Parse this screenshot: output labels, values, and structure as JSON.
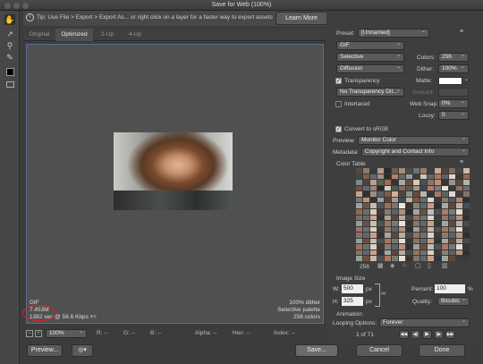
{
  "window": {
    "title": "Save for Web (100%)"
  },
  "tip": {
    "text": "Tip: Use File > Export > Export As...  or right click on a layer for a faster way to export assets",
    "learn_more": "Learn More"
  },
  "tabs": [
    {
      "label": "Original"
    },
    {
      "label": "Optimized",
      "active": true
    },
    {
      "label": "2-Up"
    },
    {
      "label": "4-Up"
    }
  ],
  "image_info": {
    "format": "GIF",
    "size": "7.453M",
    "time": "1382 sec @ 56.6 Kbps",
    "dither": "100% dither",
    "palette": "Selective palette",
    "colors": "256 colors"
  },
  "settings": {
    "preset_label": "Preset:",
    "preset_value": "[Unnamed]",
    "format": "GIF",
    "reduction": "Selective",
    "colors_label": "Colors:",
    "colors_value": "256",
    "dither_algo": "Diffusion",
    "dither_label": "Dither:",
    "dither_value": "100%",
    "transparency": "Transparency",
    "matte_label": "Matte:",
    "transparency_dither": "No Transparency Dit...",
    "amount_label": "Amount:",
    "interlaced": "Interlaced",
    "websnap_label": "Web Snap:",
    "websnap_value": "0%",
    "lossy_label": "Lossy:",
    "lossy_value": "0",
    "convert_srgb": "Convert to sRGB",
    "preview_label": "Preview:",
    "preview_value": "Monitor Color",
    "metadata_label": "Metadata:",
    "metadata_value": "Copyright and Contact Info"
  },
  "color_table": {
    "title": "Color Table",
    "count": "256",
    "swatches": [
      "#5a4a3c",
      "#8a7a6a",
      "#3d3a36",
      "#b69a86",
      "#2f2a26",
      "#6f5d4e",
      "#a88c78",
      "#484c4f",
      "#6d7277",
      "#9b7c66",
      "#3c3f43",
      "#c8a893",
      "#574238",
      "#7f6b5f",
      "#424549",
      "#d2b7a4",
      "#3e4a3f",
      "#805f4c",
      "#5f6a72",
      "#9a8f86",
      "#2d2b29",
      "#b57f63",
      "#626b5e",
      "#8f9aa3",
      "#4b3a31",
      "#c6c9c4",
      "#706256",
      "#a37b6b",
      "#5a6168",
      "#e0d2c8",
      "#3f342e",
      "#8c6c58",
      "#7b8a8f",
      "#4d4440",
      "#b9a08f",
      "#556056",
      "#9c6b52",
      "#323538",
      "#a8a9a2",
      "#6a4e40",
      "#d8c6b9",
      "#495251",
      "#7e7871",
      "#c48e75",
      "#383331",
      "#8f959a",
      "#5b4a40",
      "#b0b2ad",
      "#724f3f",
      "#636a6f",
      "#9d8171",
      "#2a2827",
      "#cfcfca",
      "#4f5a50",
      "#876553",
      "#5d5550",
      "#a39488",
      "#40484e",
      "#b77b60",
      "#7a7d7e",
      "#e7e1da",
      "#3b3836",
      "#916f5c",
      "#6a706b",
      "#c3a391",
      "#2e3331",
      "#9e8e83",
      "#576066",
      "#7d5c4b",
      "#d0b09b",
      "#4a4743",
      "#8b9189",
      "#674b3d",
      "#b8b5ae",
      "#36383b",
      "#a67760",
      "#5e635c",
      "#dad9d4",
      "#453a34",
      "#81736a",
      "#6f7980",
      "#bf937d",
      "#333230",
      "#96a0a4",
      "#5c4437",
      "#a99c92",
      "#444b4f",
      "#c9af9d",
      "#785646",
      "#676e67",
      "#e4d8cf",
      "#393d3f",
      "#8d7566",
      "#55595b",
      "#b08470",
      "#2c2e2f",
      "#9ba19c",
      "#6d5547",
      "#cab8ab",
      "#4e5558",
      "#a06d56",
      "#73776f",
      "#e9e9e4",
      "#3a3430",
      "#8a8279",
      "#5f676d",
      "#c59a84",
      "#31302f",
      "#a5a9a6",
      "#624838",
      "#bcaea3",
      "#474f55",
      "#936851",
      "#6b6f6a",
      "#d6ccc3",
      "#413c39",
      "#87796e",
      "#59646a",
      "#b58b76",
      "#2b2d2d",
      "#9fa6a2",
      "#69503f",
      "#c1bdb7",
      "#4a5052",
      "#aa7b65",
      "#787c75",
      "#e2ddd7",
      "#3d3531",
      "#7e6d61",
      "#646a6e",
      "#cda58f",
      "#303335",
      "#a2a39e",
      "#5f4536",
      "#b5aba2",
      "#43494c",
      "#98705c",
      "#6e746e",
      "#dcd3cb",
      "#423b37",
      "#8a7b6f",
      "#5a6266",
      "#bd917b",
      "#2f302f",
      "#979d9b",
      "#6c5040",
      "#c7beb6",
      "#4d5456",
      "#a47460",
      "#777a74",
      "#e6e2dc",
      "#3b3532",
      "#84766b",
      "#60666a",
      "#c99f89",
      "#323537",
      "#a6a6a0",
      "#604738",
      "#b8ada4",
      "#464c50",
      "#9c735e",
      "#6c716b",
      "#d9cfc7",
      "#403a36",
      "#8d7e72",
      "#5b6367",
      "#b98d78",
      "#2d2f30",
      "#9ba09d",
      "#6a4f3f",
      "#c4bab2",
      "#4c5355",
      "#a8785f",
      "#757973",
      "#e5e0da",
      "#3c3633",
      "#82746a",
      "#626869",
      "#cba18b",
      "#313436",
      "#a4a59f",
      "#5e4536",
      "#b6aca3",
      "#454b4f",
      "#9a725d",
      "#6d726c",
      "#dbd1c9",
      "#413b37",
      "#8b7c70",
      "#5c6468",
      "#bb8f7a",
      "#2e2f30",
      "#999e9b",
      "#6b4f3f",
      "#c5bbb3",
      "#4b5254",
      "#a6765f",
      "#767a74",
      "#e6e1db",
      "#3b3532",
      "#83756a",
      "#616768",
      "#ca9f8a",
      "#303335",
      "#a5a69f",
      "#5f4637",
      "#b7aca4",
      "#454c4f",
      "#9b735e",
      "#6c726b",
      "#dad0c8",
      "#403a37",
      "#8c7d71",
      "#5b6367",
      "#ba8e79",
      "#2e2f30",
      "#9a9f9c",
      "#6a4f3f",
      "#c4bbb3",
      "#4c5355",
      "#a7775f",
      "#767a73",
      "#e5e1da",
      "#3c3532",
      "#82756a",
      "#626869",
      "#caa08a",
      "#313436",
      "#a4a69f",
      "#5e4637",
      "#b6aca3",
      "#454b4f",
      "#9a735e",
      "#6d726c",
      "#dbd1c8",
      "#403a37",
      "#8b7d71",
      "#5c6367",
      "#bb8e79",
      "#2e2f30",
      "#999f9c",
      "#6b4f3f",
      "#c5bab3",
      "#4b5254",
      "#a6775f",
      "#767a74",
      "#e6e1da",
      "#3b3532",
      "#83756a",
      "#616869",
      "#ca9f8a",
      "#303436",
      "#a5a59f",
      "#5f4637"
    ]
  },
  "image_size": {
    "title": "Image Size",
    "w_label": "W:",
    "w_value": "500",
    "h_label": "H:",
    "h_value": "325",
    "unit": "px",
    "percent_label": "Percent:",
    "percent_value": "100",
    "percent_unit": "%",
    "quality_label": "Quality:",
    "quality_value": "Bicubic"
  },
  "animation": {
    "title": "Animation",
    "looping_label": "Looping Options:",
    "looping_value": "Forever",
    "frame": "1 of 71"
  },
  "status": {
    "zoom": "100%",
    "r": "R: --",
    "g": "G: --",
    "b": "B: --",
    "alpha": "Alpha: --",
    "hex": "Hex: --",
    "index": "Index: --"
  },
  "buttons": {
    "preview": "Preview...",
    "save": "Save...",
    "cancel": "Cancel",
    "done": "Done"
  }
}
